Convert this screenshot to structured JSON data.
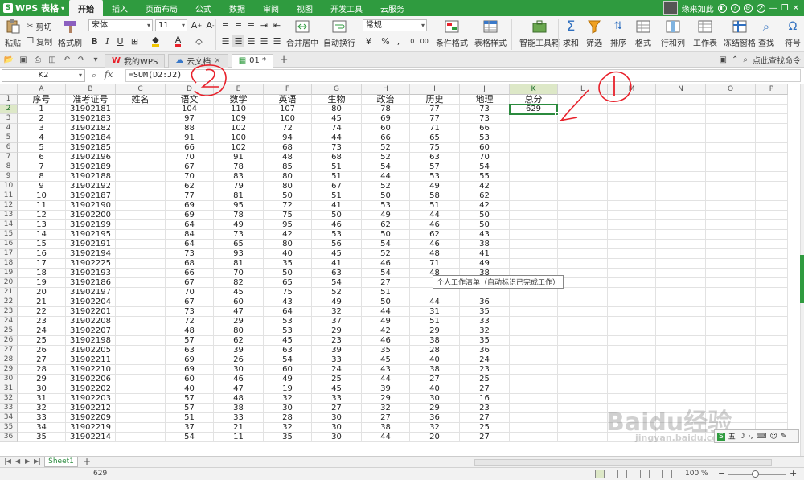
{
  "app": {
    "name": "WPS 表格",
    "logo": "S"
  },
  "menu": {
    "items": [
      "开始",
      "插入",
      "页面布局",
      "公式",
      "数据",
      "审阅",
      "视图",
      "开发工具",
      "云服务"
    ],
    "active_index": 0,
    "user": "缘来如此"
  },
  "ribbon": {
    "paste": "粘贴",
    "cut": "剪切",
    "copy": "复制",
    "format_painter": "格式刷",
    "font": "宋体",
    "font_size": "11",
    "merge_center": "合并居中",
    "wrap_text": "自动换行",
    "number_format": "常规",
    "conditional_format": "条件格式",
    "table_style": "表格样式",
    "smart_toolbox": "智能工具箱",
    "sum": "求和",
    "filter": "筛选",
    "sort": "排序",
    "format": "格式",
    "rows_cols": "行和列",
    "worksheet": "工作表",
    "freeze": "冻结窗格",
    "find": "查找",
    "symbol": "符号"
  },
  "tabs": {
    "items": [
      {
        "label": "我的WPS",
        "icon": "wps-icon",
        "closable": false
      },
      {
        "label": "云文档",
        "icon": "cloud-doc-icon",
        "closable": true
      },
      {
        "label": "01 *",
        "icon": "sheet-file-icon",
        "closable": false
      }
    ],
    "active_index": 2,
    "search_hint": "点此查找命令"
  },
  "formula_bar": {
    "cell_ref": "K2",
    "fx": "fx",
    "formula": "=SUM(D2:J2)"
  },
  "grid": {
    "columns": [
      "A",
      "B",
      "C",
      "D",
      "E",
      "F",
      "G",
      "H",
      "I",
      "J",
      "K",
      "L",
      "M",
      "N",
      "O",
      "P"
    ],
    "selected_column": "K",
    "selected_row": 2,
    "header_row": [
      "序号",
      "准考证号",
      "姓名",
      "语文",
      "数学",
      "英语",
      "生物",
      "政治",
      "历史",
      "地理",
      "总分",
      "",
      "",
      "",
      "",
      ""
    ],
    "rows": [
      [
        "1",
        "31902181",
        "",
        "104",
        "110",
        "107",
        "80",
        "78",
        "77",
        "73",
        "629"
      ],
      [
        "2",
        "31902183",
        "",
        "97",
        "109",
        "100",
        "45",
        "69",
        "77",
        "73",
        ""
      ],
      [
        "3",
        "31902182",
        "",
        "88",
        "102",
        "72",
        "74",
        "60",
        "71",
        "66",
        ""
      ],
      [
        "4",
        "31902184",
        "",
        "91",
        "100",
        "94",
        "44",
        "66",
        "65",
        "53",
        ""
      ],
      [
        "5",
        "31902185",
        "",
        "66",
        "102",
        "68",
        "73",
        "52",
        "75",
        "60",
        ""
      ],
      [
        "6",
        "31902196",
        "",
        "70",
        "91",
        "48",
        "68",
        "52",
        "63",
        "70",
        ""
      ],
      [
        "7",
        "31902189",
        "",
        "67",
        "78",
        "85",
        "51",
        "54",
        "57",
        "54",
        ""
      ],
      [
        "8",
        "31902188",
        "",
        "70",
        "83",
        "80",
        "51",
        "44",
        "53",
        "55",
        ""
      ],
      [
        "9",
        "31902192",
        "",
        "62",
        "79",
        "80",
        "67",
        "52",
        "49",
        "42",
        ""
      ],
      [
        "10",
        "31902187",
        "",
        "77",
        "81",
        "50",
        "51",
        "50",
        "58",
        "62",
        ""
      ],
      [
        "11",
        "31902190",
        "",
        "69",
        "95",
        "72",
        "41",
        "53",
        "51",
        "42",
        ""
      ],
      [
        "12",
        "31902200",
        "",
        "69",
        "78",
        "75",
        "50",
        "49",
        "44",
        "50",
        ""
      ],
      [
        "13",
        "31902199",
        "",
        "64",
        "49",
        "95",
        "46",
        "62",
        "46",
        "50",
        ""
      ],
      [
        "14",
        "31902195",
        "",
        "84",
        "73",
        "42",
        "53",
        "50",
        "62",
        "43",
        ""
      ],
      [
        "15",
        "31902191",
        "",
        "64",
        "65",
        "80",
        "56",
        "54",
        "46",
        "38",
        ""
      ],
      [
        "16",
        "31902194",
        "",
        "73",
        "93",
        "40",
        "45",
        "52",
        "48",
        "41",
        ""
      ],
      [
        "17",
        "31902225",
        "",
        "68",
        "81",
        "35",
        "41",
        "46",
        "71",
        "49",
        ""
      ],
      [
        "18",
        "31902193",
        "",
        "66",
        "70",
        "50",
        "63",
        "54",
        "48",
        "38",
        ""
      ],
      [
        "19",
        "31902186",
        "",
        "67",
        "82",
        "65",
        "54",
        "27",
        "",
        "",
        ""
      ],
      [
        "20",
        "31902197",
        "",
        "70",
        "45",
        "75",
        "52",
        "51",
        "",
        "",
        ""
      ],
      [
        "21",
        "31902204",
        "",
        "67",
        "60",
        "43",
        "49",
        "50",
        "44",
        "36",
        ""
      ],
      [
        "22",
        "31902201",
        "",
        "73",
        "47",
        "64",
        "32",
        "44",
        "31",
        "35",
        ""
      ],
      [
        "23",
        "31902208",
        "",
        "72",
        "29",
        "53",
        "37",
        "49",
        "51",
        "33",
        ""
      ],
      [
        "24",
        "31902207",
        "",
        "48",
        "80",
        "53",
        "29",
        "42",
        "29",
        "32",
        ""
      ],
      [
        "25",
        "31902198",
        "",
        "57",
        "62",
        "45",
        "23",
        "46",
        "38",
        "35",
        ""
      ],
      [
        "26",
        "31902205",
        "",
        "63",
        "39",
        "63",
        "39",
        "35",
        "28",
        "36",
        ""
      ],
      [
        "27",
        "31902211",
        "",
        "69",
        "26",
        "54",
        "33",
        "45",
        "40",
        "24",
        ""
      ],
      [
        "28",
        "31902210",
        "",
        "69",
        "30",
        "60",
        "24",
        "43",
        "38",
        "23",
        ""
      ],
      [
        "29",
        "31902206",
        "",
        "60",
        "46",
        "49",
        "25",
        "44",
        "27",
        "25",
        ""
      ],
      [
        "30",
        "31902202",
        "",
        "40",
        "47",
        "19",
        "45",
        "39",
        "40",
        "27",
        ""
      ],
      [
        "31",
        "31902203",
        "",
        "57",
        "48",
        "32",
        "33",
        "29",
        "30",
        "16",
        ""
      ],
      [
        "32",
        "31902212",
        "",
        "57",
        "38",
        "30",
        "27",
        "32",
        "29",
        "23",
        ""
      ],
      [
        "33",
        "31902209",
        "",
        "51",
        "33",
        "28",
        "30",
        "27",
        "36",
        "27",
        ""
      ],
      [
        "34",
        "31902219",
        "",
        "37",
        "21",
        "32",
        "30",
        "38",
        "32",
        "25",
        ""
      ],
      [
        "35",
        "31902214",
        "",
        "54",
        "11",
        "35",
        "30",
        "44",
        "20",
        "27",
        ""
      ]
    ],
    "tooltip": "个人工作清单（自动标识已完成工作）"
  },
  "sheets": {
    "items": [
      "Sheet1"
    ],
    "active": "Sheet1"
  },
  "status": {
    "sum_value": "629",
    "zoom": "100 %"
  },
  "annotations": {
    "label_1": "1",
    "label_2": "2",
    "color": "#e8202a"
  },
  "watermark": {
    "text": "Baidu经验",
    "sub": "jingyan.baidu.com"
  },
  "colors": {
    "brand": "#2f9b3f",
    "selection": "#2b8a3e",
    "annotation": "#e8202a"
  }
}
